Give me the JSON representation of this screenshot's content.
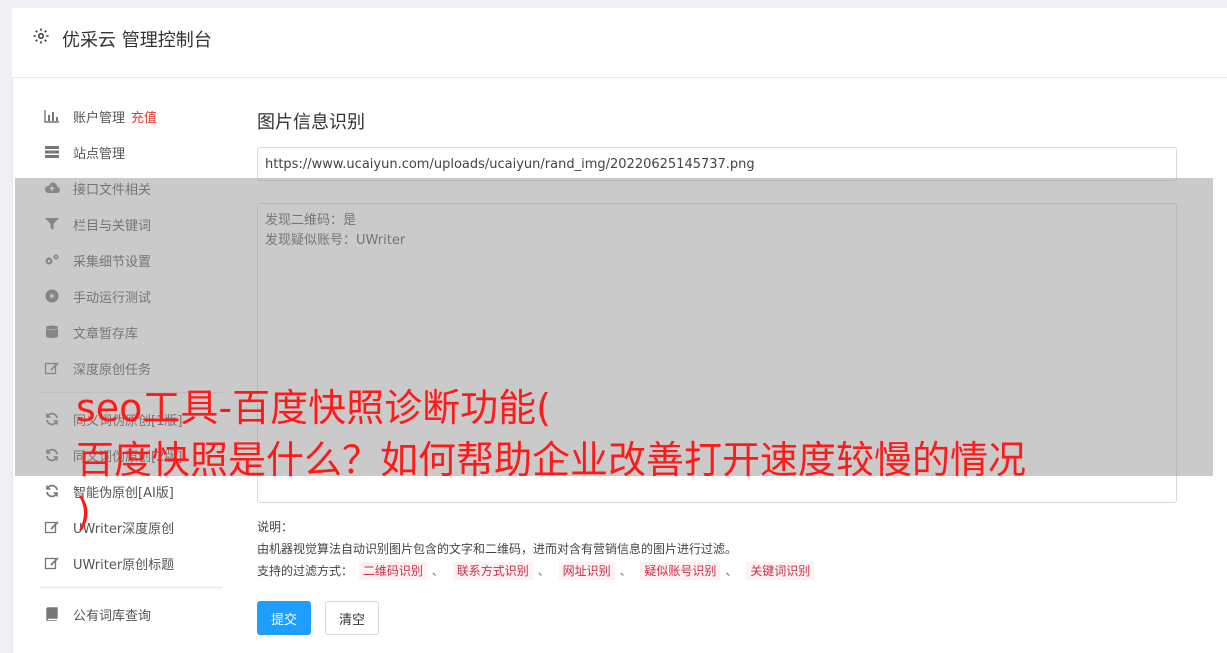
{
  "header": {
    "title": "优采云 管理控制台",
    "icon": "gear-icon"
  },
  "sidebar": {
    "items": [
      {
        "label": "账户管理",
        "extra": "充值",
        "icon": "bar-chart-icon"
      },
      {
        "label": "站点管理",
        "icon": "server-icon"
      },
      {
        "label": "接口文件相关",
        "icon": "cloud-upload-icon"
      },
      {
        "label": "栏目与关键词",
        "icon": "filter-icon"
      },
      {
        "label": "采集细节设置",
        "icon": "gears-icon"
      },
      {
        "label": "手动运行测试",
        "icon": "play-circle-icon"
      },
      {
        "label": "文章暂存库",
        "icon": "database-icon"
      },
      {
        "label": "深度原创任务",
        "icon": "edit-icon"
      },
      {
        "label": "同义词伪原创[1版]",
        "icon": "refresh-icon"
      },
      {
        "label": "同义词伪原创[2版]",
        "icon": "refresh-icon"
      },
      {
        "label": "智能伪原创[AI版]",
        "icon": "refresh-icon"
      },
      {
        "label": "UWriter深度原创",
        "icon": "edit-icon"
      },
      {
        "label": "UWriter原创标题",
        "icon": "edit-icon"
      },
      {
        "label": "公有词库查询",
        "icon": "book-icon"
      }
    ]
  },
  "main": {
    "title": "图片信息识别",
    "url_value": "https://www.ucaiyun.com/uploads/ucaiyun/rand_img/20220625145737.png",
    "result_lines": [
      "发现二维码：是",
      "发现疑似账号：UWriter"
    ],
    "notes_label": "说明：",
    "notes_text": "由机器视觉算法自动识别图片包含的文字和二维码，进而对含有营销信息的图片进行过滤。",
    "filter_label": "支持的过滤方式：",
    "filters": [
      "二维码识别",
      "联系方式识别",
      "网址识别",
      "疑似账号识别",
      "关键词识别"
    ],
    "filter_sep": "、",
    "submit_label": "提交",
    "clear_label": "清空"
  },
  "overlay": {
    "headline": "seo工具-百度快照诊断功能(\n百度快照是什么？如何帮助企业改善打开速度较慢的情况\n)"
  },
  "colors": {
    "accent": "#1e9fff",
    "recharge": "#e03a2e",
    "headline": "#ff1a1a",
    "tag": "#c8304a"
  }
}
